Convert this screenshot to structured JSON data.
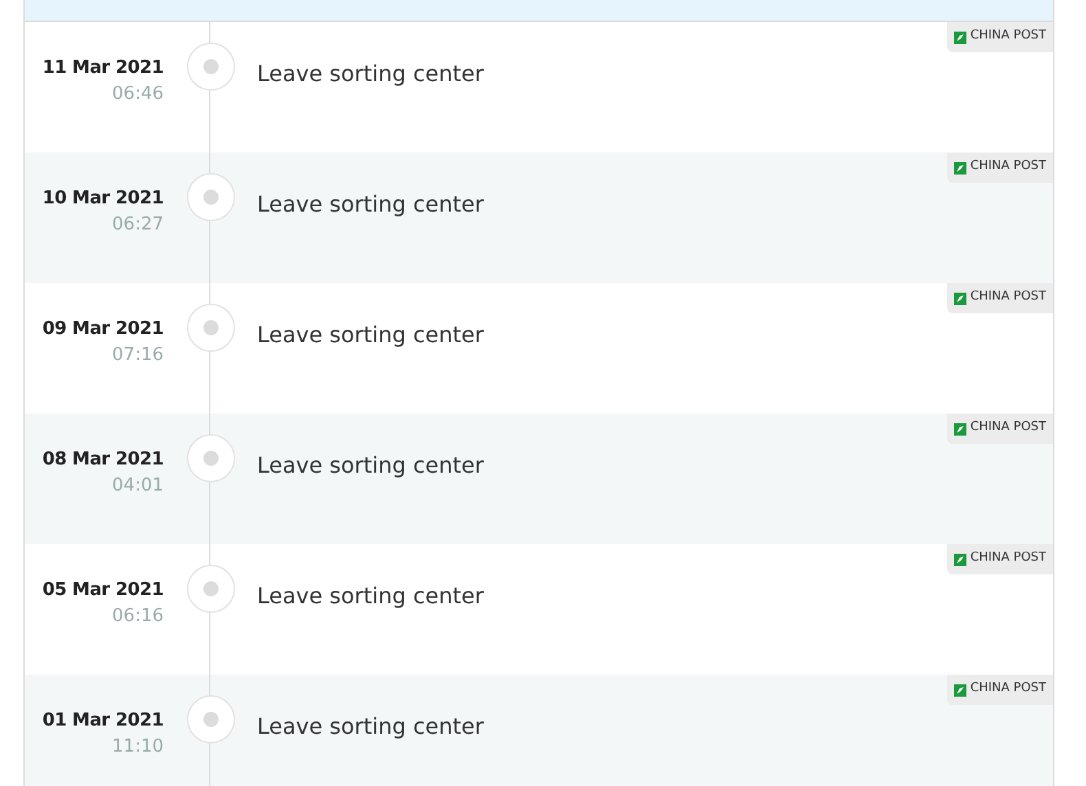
{
  "events": [
    {
      "date": "11 Mar 2021",
      "time": "06:46",
      "description": "Leave sorting center",
      "carrier": "CHINA POST"
    },
    {
      "date": "10 Mar 2021",
      "time": "06:27",
      "description": "Leave sorting center",
      "carrier": "CHINA POST"
    },
    {
      "date": "09 Mar 2021",
      "time": "07:16",
      "description": "Leave sorting center",
      "carrier": "CHINA POST"
    },
    {
      "date": "08 Mar 2021",
      "time": "04:01",
      "description": "Leave sorting center",
      "carrier": "CHINA POST"
    },
    {
      "date": "05 Mar 2021",
      "time": "06:16",
      "description": "Leave sorting center",
      "carrier": "CHINA POST"
    },
    {
      "date": "01 Mar 2021",
      "time": "11:10",
      "description": "Leave sorting center",
      "carrier": "CHINA POST"
    }
  ]
}
